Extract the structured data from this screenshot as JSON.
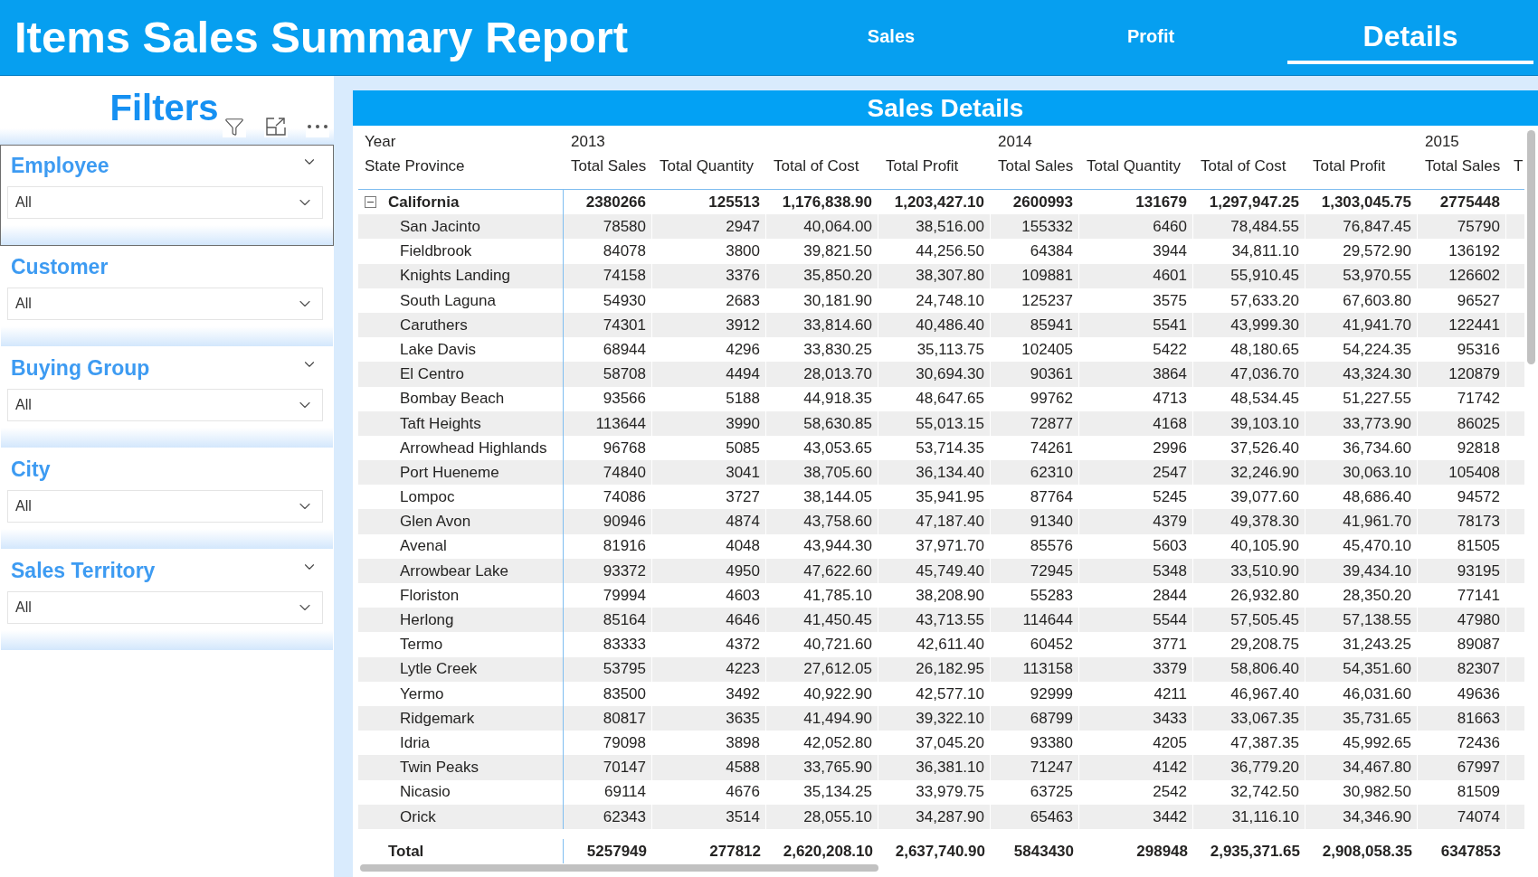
{
  "header": {
    "title": "Items Sales Summary Report",
    "tabs": [
      {
        "label": "Sales",
        "selected": false
      },
      {
        "label": "Profit",
        "selected": false
      },
      {
        "label": "Details",
        "selected": true
      }
    ]
  },
  "filters": {
    "title": "Filters",
    "slicers": [
      {
        "label": "Employee",
        "value": "All",
        "focused": true,
        "header_chevron": true
      },
      {
        "label": "Customer",
        "value": "All",
        "focused": false,
        "header_chevron": false
      },
      {
        "label": "Buying Group",
        "value": "All",
        "focused": false,
        "header_chevron": true
      },
      {
        "label": "City",
        "value": "All",
        "focused": false,
        "header_chevron": false
      },
      {
        "label": "Sales Territory",
        "value": "All",
        "focused": false,
        "header_chevron": true
      }
    ]
  },
  "table": {
    "title": "Sales Details",
    "corner_labels": [
      "Year",
      "State Province"
    ],
    "column_groups": [
      {
        "year": "2013",
        "columns": [
          "Total Sales",
          "Total Quantity",
          "Total of Cost",
          "Total Profit"
        ]
      },
      {
        "year": "2014",
        "columns": [
          "Total Sales",
          "Total Quantity",
          "Total of Cost",
          "Total Profit"
        ]
      },
      {
        "year": "2015",
        "columns": [
          "Total Sales",
          "T"
        ]
      }
    ],
    "rows": [
      {
        "label": "California",
        "expanded": true,
        "values": [
          "2380266",
          "125513",
          "1,176,838.90",
          "1,203,427.10",
          "2600993",
          "131679",
          "1,297,947.25",
          "1,303,045.75",
          "2775448"
        ],
        "children": [
          {
            "label": "San Jacinto",
            "values": [
              "78580",
              "2947",
              "40,064.00",
              "38,516.00",
              "155332",
              "6460",
              "78,484.55",
              "76,847.45",
              "75790"
            ]
          },
          {
            "label": "Fieldbrook",
            "values": [
              "84078",
              "3800",
              "39,821.50",
              "44,256.50",
              "64384",
              "3944",
              "34,811.10",
              "29,572.90",
              "136192"
            ]
          },
          {
            "label": "Knights Landing",
            "values": [
              "74158",
              "3376",
              "35,850.20",
              "38,307.80",
              "109881",
              "4601",
              "55,910.45",
              "53,970.55",
              "126602"
            ]
          },
          {
            "label": "South Laguna",
            "values": [
              "54930",
              "2683",
              "30,181.90",
              "24,748.10",
              "125237",
              "3575",
              "57,633.20",
              "67,603.80",
              "96527"
            ]
          },
          {
            "label": "Caruthers",
            "values": [
              "74301",
              "3912",
              "33,814.60",
              "40,486.40",
              "85941",
              "5541",
              "43,999.30",
              "41,941.70",
              "122441"
            ]
          },
          {
            "label": "Lake Davis",
            "values": [
              "68944",
              "4296",
              "33,830.25",
              "35,113.75",
              "102405",
              "5422",
              "48,180.65",
              "54,224.35",
              "95316"
            ]
          },
          {
            "label": "El Centro",
            "values": [
              "58708",
              "4494",
              "28,013.70",
              "30,694.30",
              "90361",
              "3864",
              "47,036.70",
              "43,324.30",
              "120879"
            ]
          },
          {
            "label": "Bombay Beach",
            "values": [
              "93566",
              "5188",
              "44,918.35",
              "48,647.65",
              "99762",
              "4713",
              "48,534.45",
              "51,227.55",
              "71742"
            ]
          },
          {
            "label": "Taft Heights",
            "values": [
              "113644",
              "3990",
              "58,630.85",
              "55,013.15",
              "72877",
              "4168",
              "39,103.10",
              "33,773.90",
              "86025"
            ]
          },
          {
            "label": "Arrowhead Highlands",
            "values": [
              "96768",
              "5085",
              "43,053.65",
              "53,714.35",
              "74261",
              "2996",
              "37,526.40",
              "36,734.60",
              "92818"
            ]
          },
          {
            "label": "Port Hueneme",
            "values": [
              "74840",
              "3041",
              "38,705.60",
              "36,134.40",
              "62310",
              "2547",
              "32,246.90",
              "30,063.10",
              "105408"
            ]
          },
          {
            "label": "Lompoc",
            "values": [
              "74086",
              "3727",
              "38,144.05",
              "35,941.95",
              "87764",
              "5245",
              "39,077.60",
              "48,686.40",
              "94572"
            ]
          },
          {
            "label": "Glen Avon",
            "values": [
              "90946",
              "4874",
              "43,758.60",
              "47,187.40",
              "91340",
              "4379",
              "49,378.30",
              "41,961.70",
              "78173"
            ]
          },
          {
            "label": "Avenal",
            "values": [
              "81916",
              "4048",
              "43,944.30",
              "37,971.70",
              "85576",
              "5603",
              "40,105.90",
              "45,470.10",
              "81505"
            ]
          },
          {
            "label": "Arrowbear Lake",
            "values": [
              "93372",
              "4950",
              "47,622.60",
              "45,749.40",
              "72945",
              "5348",
              "33,510.90",
              "39,434.10",
              "93195"
            ]
          },
          {
            "label": "Floriston",
            "values": [
              "79994",
              "4603",
              "41,785.10",
              "38,208.90",
              "55283",
              "2844",
              "26,932.80",
              "28,350.20",
              "77141"
            ]
          },
          {
            "label": "Herlong",
            "values": [
              "85164",
              "4646",
              "41,450.45",
              "43,713.55",
              "114644",
              "5544",
              "57,505.45",
              "57,138.55",
              "47980"
            ]
          },
          {
            "label": "Termo",
            "values": [
              "83333",
              "4372",
              "40,721.60",
              "42,611.40",
              "60452",
              "3771",
              "29,208.75",
              "31,243.25",
              "89087"
            ]
          },
          {
            "label": "Lytle Creek",
            "values": [
              "53795",
              "4223",
              "27,612.05",
              "26,182.95",
              "113158",
              "3379",
              "58,806.40",
              "54,351.60",
              "82307"
            ]
          },
          {
            "label": "Yermo",
            "values": [
              "83500",
              "3492",
              "40,922.90",
              "42,577.10",
              "92999",
              "4211",
              "46,967.40",
              "46,031.60",
              "49636"
            ]
          },
          {
            "label": "Ridgemark",
            "values": [
              "80817",
              "3635",
              "41,494.90",
              "39,322.10",
              "68799",
              "3433",
              "33,067.35",
              "35,731.65",
              "81663"
            ]
          },
          {
            "label": "Idria",
            "values": [
              "79098",
              "3898",
              "42,052.80",
              "37,045.20",
              "93380",
              "4205",
              "47,387.35",
              "45,992.65",
              "72436"
            ]
          },
          {
            "label": "Twin Peaks",
            "values": [
              "70147",
              "4588",
              "33,765.90",
              "36,381.10",
              "71247",
              "4142",
              "36,779.20",
              "34,467.80",
              "67997"
            ]
          },
          {
            "label": "Nicasio",
            "values": [
              "69114",
              "4676",
              "35,134.25",
              "33,979.75",
              "63725",
              "2542",
              "32,742.50",
              "30,982.50",
              "81509"
            ]
          },
          {
            "label": "Orick",
            "values": [
              "62343",
              "3514",
              "28,055.10",
              "34,287.90",
              "65463",
              "3442",
              "31,116.10",
              "34,346.90",
              "74074"
            ]
          }
        ]
      }
    ],
    "total": {
      "label": "Total",
      "values": [
        "5257949",
        "277812",
        "2,620,208.10",
        "2,637,740.90",
        "5843430",
        "298948",
        "2,935,371.65",
        "2,908,058.35",
        "6347853"
      ]
    }
  }
}
